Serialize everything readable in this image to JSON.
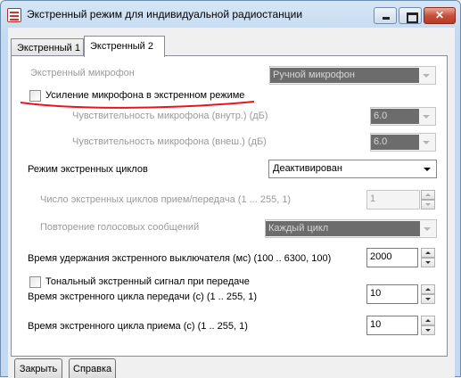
{
  "window": {
    "title": "Экстренный режим для индивидуальной радиостанции"
  },
  "tabs": [
    {
      "label": "Экстренный 1"
    },
    {
      "label": "Экстренный 2"
    }
  ],
  "form": {
    "mic": {
      "label": "Экстренный микрофон",
      "value": "Ручной микрофон"
    },
    "mic_gain": {
      "label": "Усиление микрофона в экстренном режиме",
      "checked": false
    },
    "sens_int": {
      "label": "Чувствительность микрофона (внутр.) (дБ)",
      "value": "6.0"
    },
    "sens_ext": {
      "label": "Чувствительность микрофона (внеш.) (дБ)",
      "value": "6.0"
    },
    "cycle_mode": {
      "label": "Режим экстренных циклов",
      "value": "Деактивирован"
    },
    "cycle_count": {
      "label": "Число экстренных циклов прием/передача (1 ... 255, 1)",
      "value": "1"
    },
    "voice_repeat": {
      "label": "Повторение голосовых сообщений",
      "value": "Каждый цикл"
    },
    "hold_time": {
      "label": "Время удержания экстренного выключателя (мс)  (100 .. 6300, 100)",
      "value": "2000"
    },
    "tone_signal": {
      "label": "Тональный экстренный сигнал при передаче",
      "checked": false
    },
    "tx_cycle": {
      "label": "Время экстренного цикла передачи (с) (1 .. 255, 1)",
      "value": "10"
    },
    "rx_cycle": {
      "label": "Время экстренного цикла приема (с) (1 .. 255, 1)",
      "value": "10"
    }
  },
  "footer": {
    "close_label": "Закрыть",
    "help_label": "Справка"
  },
  "colors": {
    "annotation_underline": "#e8141d",
    "disabled_fill": "#6c6c6c"
  }
}
